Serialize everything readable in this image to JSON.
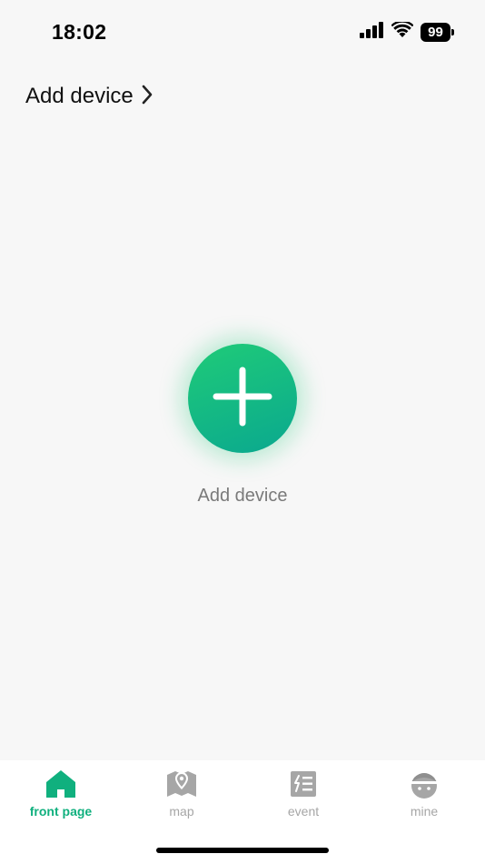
{
  "status_bar": {
    "time": "18:02",
    "battery": "99",
    "icons": [
      "signal-icon",
      "wifi-icon",
      "battery-icon"
    ]
  },
  "header": {
    "title": "Add device",
    "icon": "chevron-right-icon"
  },
  "main": {
    "add_button_icon": "plus-icon",
    "add_label": "Add device"
  },
  "tabs": [
    {
      "label": "front page",
      "icon": "home-icon",
      "active": true
    },
    {
      "label": "map",
      "icon": "map-pin-icon",
      "active": false
    },
    {
      "label": "event",
      "icon": "event-list-icon",
      "active": false
    },
    {
      "label": "mine",
      "icon": "profile-icon",
      "active": false
    }
  ],
  "colors": {
    "accent": "#10b07e",
    "button_gradient_start": "#1fcb78",
    "button_gradient_end": "#0aa88f",
    "inactive": "#a6a6a6",
    "background": "#f7f7f7"
  }
}
